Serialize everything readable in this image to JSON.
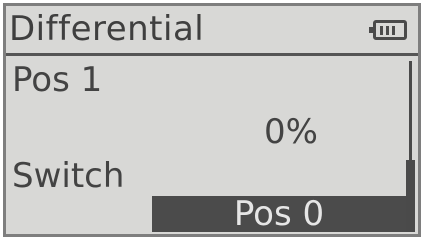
{
  "header": {
    "title": "Differential",
    "battery_icon": "battery-icon"
  },
  "item": {
    "label": "Pos 1",
    "value": "0%"
  },
  "switch": {
    "label": "Switch",
    "value": "Pos 0"
  },
  "colors": {
    "screen_bg": "#d8d8d6",
    "text": "#434343",
    "highlight_bg": "#4b4b4b",
    "highlight_text": "#e6e6e6"
  },
  "scroll": {
    "position": "bottom"
  }
}
